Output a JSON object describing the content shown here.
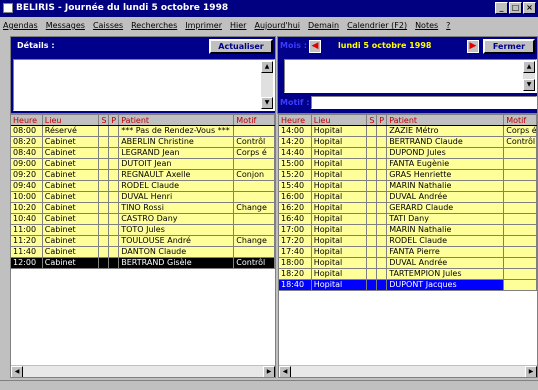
{
  "window": {
    "title": "BELIRIS - Journée du lundi 5 octobre 1998"
  },
  "menu": [
    "Agendas",
    "Messages",
    "Caisses",
    "Recherches",
    "Imprimer",
    "Hier",
    "Aujourd'hui",
    "Demain",
    "Calendrier (F2)",
    "Notes",
    "?"
  ],
  "details": {
    "label": "Détails :",
    "button": "Actualiser"
  },
  "date_nav": {
    "mois_label": "Mois :",
    "date": "lundi 5 octobre 1998",
    "close_button": "Fermer",
    "motif_label": "Motif :"
  },
  "columns": [
    "Heure",
    "Lieu",
    "S",
    "P",
    "Patient",
    "Motif"
  ],
  "left_rows": [
    [
      "08:00",
      "Réservé",
      "",
      "",
      "*** Pas de Rendez-Vous ***",
      ""
    ],
    [
      "08:20",
      "Cabinet",
      "",
      "",
      "ABERLIN Christine",
      "Contrôl"
    ],
    [
      "08:40",
      "Cabinet",
      "",
      "",
      "LEGRAND Jean",
      "Corps é"
    ],
    [
      "09:00",
      "Cabinet",
      "",
      "",
      "DUTOIT Jean",
      ""
    ],
    [
      "09:20",
      "Cabinet",
      "",
      "",
      "REGNAULT Axelle",
      "Conjon"
    ],
    [
      "09:40",
      "Cabinet",
      "",
      "",
      "RODEL Claude",
      ""
    ],
    [
      "10:00",
      "Cabinet",
      "",
      "",
      "DUVAL Henri",
      ""
    ],
    [
      "10:20",
      "Cabinet",
      "",
      "",
      "TINO Rossi",
      "Change"
    ],
    [
      "10:40",
      "Cabinet",
      "",
      "",
      "CASTRO Dany",
      ""
    ],
    [
      "11:00",
      "Cabinet",
      "",
      "",
      "TOTO Jules",
      ""
    ],
    [
      "11:20",
      "Cabinet",
      "",
      "",
      "TOULOUSE André",
      "Change"
    ],
    [
      "11:40",
      "Cabinet",
      "",
      "",
      "DANTON Claude",
      ""
    ],
    [
      "12:00",
      "Cabinet",
      "",
      "",
      "BERTRAND Gisèle",
      "Contrôl"
    ]
  ],
  "right_rows": [
    [
      "14:00",
      "Hopital",
      "",
      "",
      "ZAZIE Métro",
      "Corps é"
    ],
    [
      "14:20",
      "Hopital",
      "",
      "",
      "BERTRAND Claude",
      "Contrôl"
    ],
    [
      "14:40",
      "Hopital",
      "",
      "",
      "DUPOND Jules",
      ""
    ],
    [
      "15:00",
      "Hopital",
      "",
      "",
      "FANTA Eugènie",
      ""
    ],
    [
      "15:20",
      "Hopital",
      "",
      "",
      "GRAS Henriette",
      ""
    ],
    [
      "15:40",
      "Hopital",
      "",
      "",
      "MARIN Nathalie",
      ""
    ],
    [
      "16:00",
      "Hopital",
      "",
      "",
      "DUVAL Andrée",
      ""
    ],
    [
      "16:20",
      "Hopital",
      "",
      "",
      "GERARD Claude",
      ""
    ],
    [
      "16:40",
      "Hopital",
      "",
      "",
      "TATI Dany",
      ""
    ],
    [
      "17:00",
      "Hopital",
      "",
      "",
      "MARIN Nathalie",
      ""
    ],
    [
      "17:20",
      "Hopital",
      "",
      "",
      "RODEL Claude",
      ""
    ],
    [
      "17:40",
      "Hopital",
      "",
      "",
      "FANTA Pierre",
      ""
    ],
    [
      "18:00",
      "Hopital",
      "",
      "",
      "DUVAL Andrée",
      ""
    ],
    [
      "18:20",
      "Hopital",
      "",
      "",
      "TARTEMPION Jules",
      ""
    ],
    [
      "18:40",
      "Hopital",
      "",
      "",
      "DUPONT Jacques",
      ""
    ]
  ]
}
